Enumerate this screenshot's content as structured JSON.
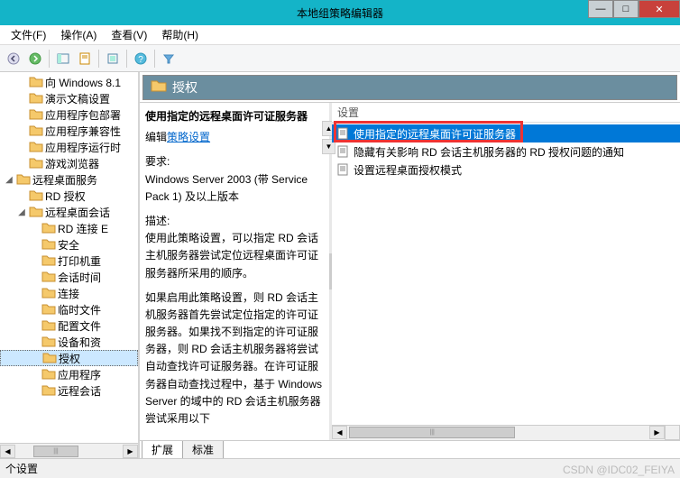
{
  "window": {
    "title": "本地组策略编辑器"
  },
  "menu": {
    "file": "文件(F)",
    "action": "操作(A)",
    "view": "查看(V)",
    "help": "帮助(H)"
  },
  "tree": {
    "items": [
      {
        "indent": 1,
        "tw": "",
        "label": "向 Windows 8.1"
      },
      {
        "indent": 1,
        "tw": "",
        "label": "演示文稿设置"
      },
      {
        "indent": 1,
        "tw": "",
        "label": "应用程序包部署"
      },
      {
        "indent": 1,
        "tw": "",
        "label": "应用程序兼容性"
      },
      {
        "indent": 1,
        "tw": "",
        "label": "应用程序运行时"
      },
      {
        "indent": 1,
        "tw": "",
        "label": "游戏浏览器"
      },
      {
        "indent": 0,
        "tw": "◢",
        "label": "远程桌面服务"
      },
      {
        "indent": 1,
        "tw": "",
        "label": "RD 授权"
      },
      {
        "indent": 1,
        "tw": "◢",
        "label": "远程桌面会话"
      },
      {
        "indent": 2,
        "tw": "",
        "label": "RD 连接 E"
      },
      {
        "indent": 2,
        "tw": "",
        "label": "安全"
      },
      {
        "indent": 2,
        "tw": "",
        "label": "打印机重"
      },
      {
        "indent": 2,
        "tw": "",
        "label": "会话时间"
      },
      {
        "indent": 2,
        "tw": "",
        "label": "连接"
      },
      {
        "indent": 2,
        "tw": "",
        "label": "临时文件"
      },
      {
        "indent": 2,
        "tw": "",
        "label": "配置文件"
      },
      {
        "indent": 2,
        "tw": "",
        "label": "设备和资"
      },
      {
        "indent": 2,
        "tw": "",
        "label": "授权",
        "selected": true
      },
      {
        "indent": 2,
        "tw": "",
        "label": "应用程序"
      },
      {
        "indent": 2,
        "tw": "",
        "label": "远程会话"
      }
    ]
  },
  "header": {
    "title": "授权"
  },
  "desc": {
    "policy_title": "使用指定的远程桌面许可证服务器",
    "edit_prefix": "编辑",
    "edit_link": "策略设置",
    "req_label": "要求:",
    "req_text": "Windows Server 2003 (带 Service Pack 1) 及以上版本",
    "desc_label": "描述:",
    "p1": "使用此策略设置，可以指定 RD 会话主机服务器尝试定位远程桌面许可证服务器所采用的顺序。",
    "p2": "如果启用此策略设置，则 RD 会话主机服务器首先尝试定位指定的许可证服务器。如果找不到指定的许可证服务器，则 RD 会话主机服务器将尝试自动查找许可证服务器。在许可证服务器自动查找过程中，基于 Windows Server 的域中的 RD 会话主机服务器尝试采用以下"
  },
  "list": {
    "header": "设置",
    "items": [
      {
        "label": "使用指定的远程桌面许可证服务器",
        "selected": true
      },
      {
        "label": "隐藏有关影响 RD 会话主机服务器的 RD 授权问题的通知"
      },
      {
        "label": "设置远程桌面授权模式"
      }
    ]
  },
  "tabs": {
    "extended": "扩展",
    "standard": "标准"
  },
  "status": {
    "text": " 个设置"
  },
  "watermark": "CSDN @IDC02_FEIYA"
}
